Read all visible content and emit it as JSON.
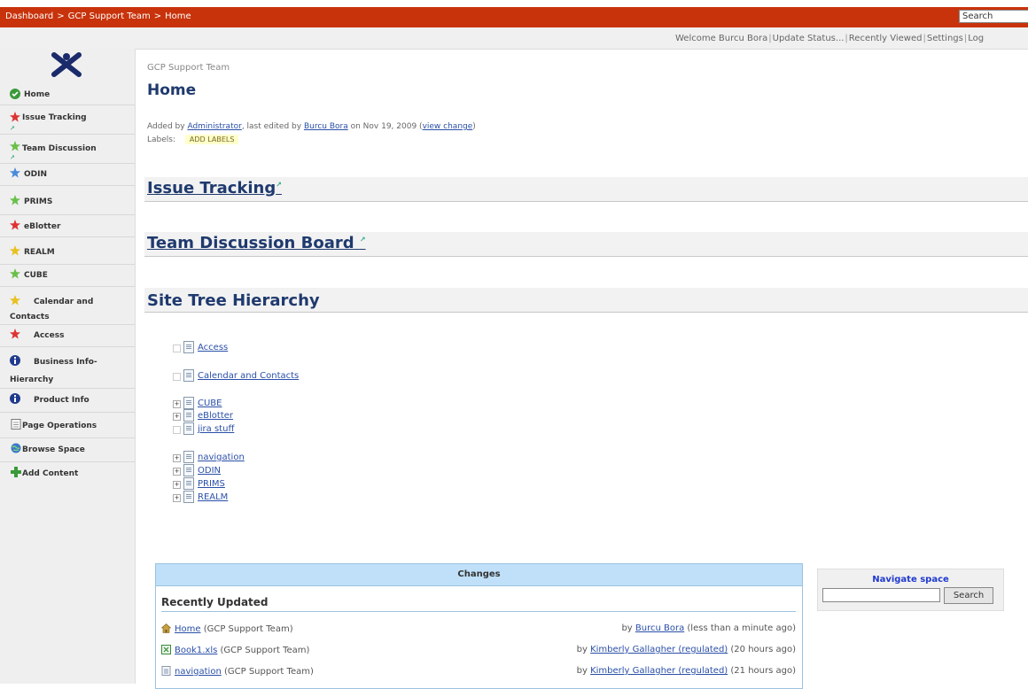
{
  "topbar": {
    "crumbs": [
      "Dashboard",
      "GCP Support Team",
      "Home"
    ],
    "search_value": "Search"
  },
  "userbar": {
    "welcome": "Welcome Burcu Bora",
    "links": [
      "Update Status...",
      "Recently Viewed",
      "Settings",
      "Log"
    ]
  },
  "sidebar": {
    "items": [
      {
        "label": "Home",
        "icon": "check-icon",
        "color": "#3a9a3a"
      },
      {
        "label": "Issue Tracking",
        "icon": "star-icon",
        "color": "#dd3333"
      },
      {
        "label": "Team Discussion",
        "icon": "star-icon",
        "color": "#6abf4b"
      },
      {
        "label": "ODIN",
        "icon": "star-icon",
        "color": "#4a8ad8"
      },
      {
        "label": "PRIMS",
        "icon": "star-icon",
        "color": "#6abf4b"
      },
      {
        "label": "eBlotter",
        "icon": "star-icon",
        "color": "#dd3333"
      },
      {
        "label": "REALM",
        "icon": "star-icon",
        "color": "#e8c020"
      },
      {
        "label": "CUBE",
        "icon": "star-icon",
        "color": "#6abf4b"
      },
      {
        "label_1": "Calendar and",
        "label_2": "Contacts",
        "icon": "star-icon",
        "color": "#e8c020"
      },
      {
        "label": "Access",
        "icon": "star-icon",
        "color": "#dd3333"
      },
      {
        "label_1": "Business Info-",
        "label_2": "Hierarchy",
        "icon": "info-icon",
        "color": "#1f3a8e"
      },
      {
        "label": "Product Info",
        "icon": "info-icon",
        "color": "#1f3a8e"
      },
      {
        "label": "Page Operations",
        "icon": "page-icon",
        "color": "#777777"
      },
      {
        "label": "Browse Space",
        "icon": "globe-icon",
        "color": "#3a7ac8"
      },
      {
        "label": "Add Content",
        "icon": "plus-icon",
        "color": "#3a9a3a"
      }
    ]
  },
  "main": {
    "space_title": "GCP Support Team",
    "page_title": "Home",
    "meta": {
      "added_by_prefix": "Added by",
      "added_by": "Administrator",
      "edited_prefix": ", last edited by",
      "edited_by": "Burcu Bora",
      "date": "on Nov 19, 2009",
      "view_change": "view change"
    },
    "labels_label": "Labels:",
    "add_labels": "ADD LABELS",
    "sections": {
      "issue_tracking": "Issue Tracking",
      "team_discussion": "Team Discussion Board",
      "site_tree": "Site Tree Hierarchy"
    },
    "tree": [
      {
        "label": "Access",
        "expand": ""
      },
      {
        "label": "Calendar and Contacts",
        "expand": ""
      },
      {
        "label": "CUBE",
        "expand": "+"
      },
      {
        "label": "eBlotter",
        "expand": "+"
      },
      {
        "label": "jira stuff",
        "expand": ""
      },
      {
        "label": "navigation",
        "expand": "+"
      },
      {
        "label": "ODIN",
        "expand": "+"
      },
      {
        "label": "PRIMS",
        "expand": "+"
      },
      {
        "label": "REALM",
        "expand": "+"
      }
    ],
    "changes": {
      "header": "Changes",
      "subheader": "Recently Updated",
      "rows": [
        {
          "title": "Home",
          "space": "(GCP Support Team)",
          "by_prefix": "by",
          "by": "Burcu Bora",
          "when": "(less than a minute ago)",
          "icon": "home-icon"
        },
        {
          "title": "Book1.xls",
          "space": "(GCP Support Team)",
          "by_prefix": "by",
          "by": "Kimberly Gallagher (regulated)",
          "when": "(20 hours ago)",
          "icon": "excel-icon"
        },
        {
          "title": "navigation",
          "space": "(GCP Support Team)",
          "by_prefix": "by",
          "by": "Kimberly Gallagher (regulated)",
          "when": "(21 hours ago)",
          "icon": "page-icon"
        }
      ]
    },
    "navigate_space": {
      "title": "Navigate space",
      "input_value": "",
      "button": "Search"
    }
  }
}
